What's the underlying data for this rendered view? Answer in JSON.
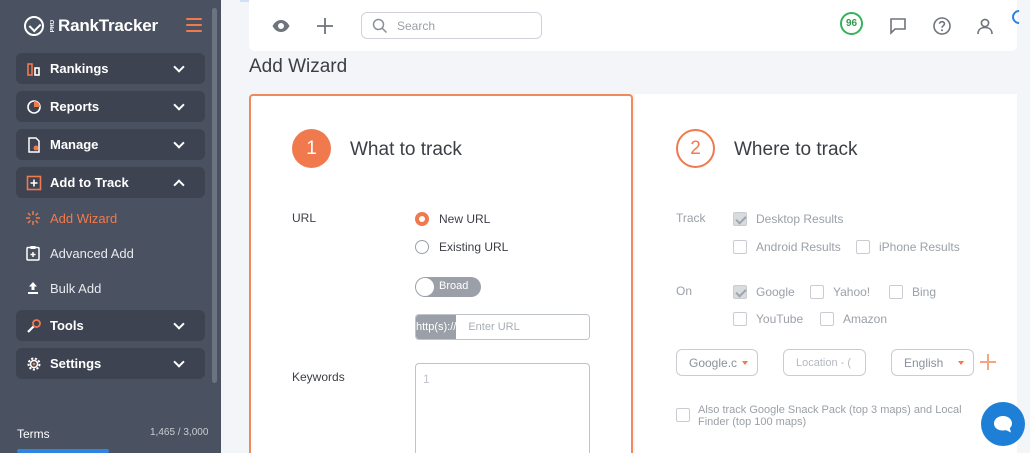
{
  "sidebar": {
    "logo_text": "RankTracker",
    "logo_pro": "PRO",
    "nav": [
      {
        "label": "Rankings"
      },
      {
        "label": "Reports"
      },
      {
        "label": "Manage"
      },
      {
        "label": "Add to Track"
      },
      {
        "label": "Tools"
      },
      {
        "label": "Settings"
      }
    ],
    "sub_items": [
      {
        "label": "Add Wizard",
        "active": true
      },
      {
        "label": "Advanced Add"
      },
      {
        "label": "Bulk Add"
      }
    ],
    "terms_label": "Terms",
    "terms_count": "1,465 / 3,000",
    "terms_usage": 0.488
  },
  "topbar": {
    "search_placeholder": "Search",
    "score": "96"
  },
  "page_title": "Add Wizard",
  "step1": {
    "number": "1",
    "title": "What to track",
    "url_label": "URL",
    "radio_new": "New URL",
    "radio_existing": "Existing URL",
    "toggle_label": "Broad",
    "url_prefix": "http(s)://",
    "url_placeholder": "Enter URL",
    "keywords_label": "Keywords",
    "keywords_placeholder": "1"
  },
  "step2": {
    "number": "2",
    "title": "Where to track",
    "track_label": "Track",
    "track_options": [
      "Desktop Results",
      "Android Results",
      "iPhone Results"
    ],
    "on_label": "On",
    "engines": [
      "Google",
      "Yahoo!",
      "Bing",
      "YouTube",
      "Amazon"
    ],
    "select_engine": "Google.c",
    "select_location_placeholder": "Location - (",
    "select_language": "English",
    "snack_text": "Also track Google Snack Pack (top 3 maps) and Local Finder (top 100 maps)"
  },
  "colors": {
    "accent": "#f07a4e",
    "sidebar_bg": "#4a5160",
    "nav_bg": "#3d4350",
    "score_green": "#34b35a",
    "chat_blue": "#1e7fd6"
  }
}
